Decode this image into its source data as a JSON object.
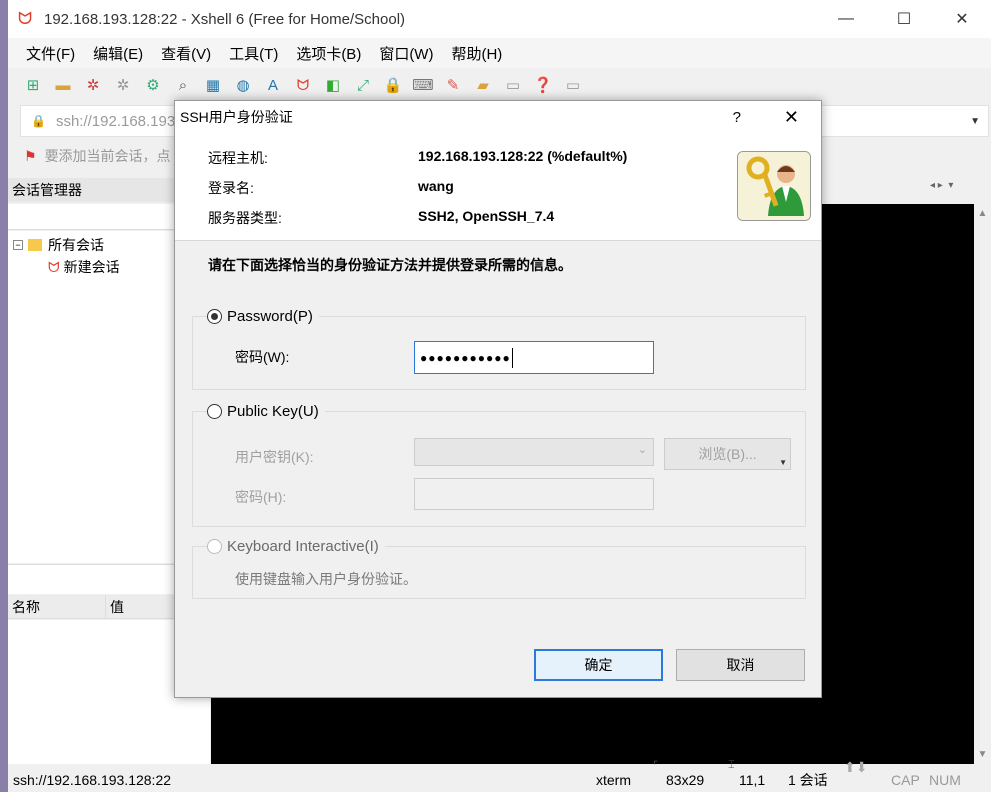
{
  "window": {
    "title": "192.168.193.128:22 - Xshell 6 (Free for Home/School)",
    "minimize": "—",
    "maximize": "☐",
    "close": "✕"
  },
  "menu": [
    "文件(F)",
    "编辑(E)",
    "查看(V)",
    "工具(T)",
    "选项卡(B)",
    "窗口(W)",
    "帮助(H)"
  ],
  "address": {
    "text": "ssh://192.168.193"
  },
  "hint": {
    "text": "要添加当前会话，点"
  },
  "sessions": {
    "header": "会话管理器",
    "root": "所有会话",
    "child": "新建会话"
  },
  "props": {
    "col_name": "名称",
    "col_value": "值"
  },
  "status": {
    "url": "ssh://192.168.193.128:22",
    "term": "xterm",
    "size": "83x29",
    "pos": "11,1",
    "sessions": "1 会话",
    "cap": "CAP",
    "num": "NUM"
  },
  "dialog": {
    "title": "SSH用户身份验证",
    "help": "?",
    "close": "✕",
    "host_label": "远程主机:",
    "host_value": "192.168.193.128:22 (%default%)",
    "user_label": "登录名:",
    "user_value": "wang",
    "server_label": "服务器类型:",
    "server_value": "SSH2, OpenSSH_7.4",
    "instruction": "请在下面选择恰当的身份验证方法并提供登录所需的信息。",
    "password_option": "Password(P)",
    "password_label": "密码(W):",
    "password_value": "●●●●●●●●●●●",
    "pubkey_option": "Public Key(U)",
    "userkey_label": "用户密钥(K):",
    "browse_label": "浏览(B)...",
    "passphrase_label": "密码(H):",
    "kbd_option": "Keyboard Interactive(I)",
    "kbd_desc": "使用键盘输入用户身份验证。",
    "ok": "确定",
    "cancel": "取消"
  }
}
